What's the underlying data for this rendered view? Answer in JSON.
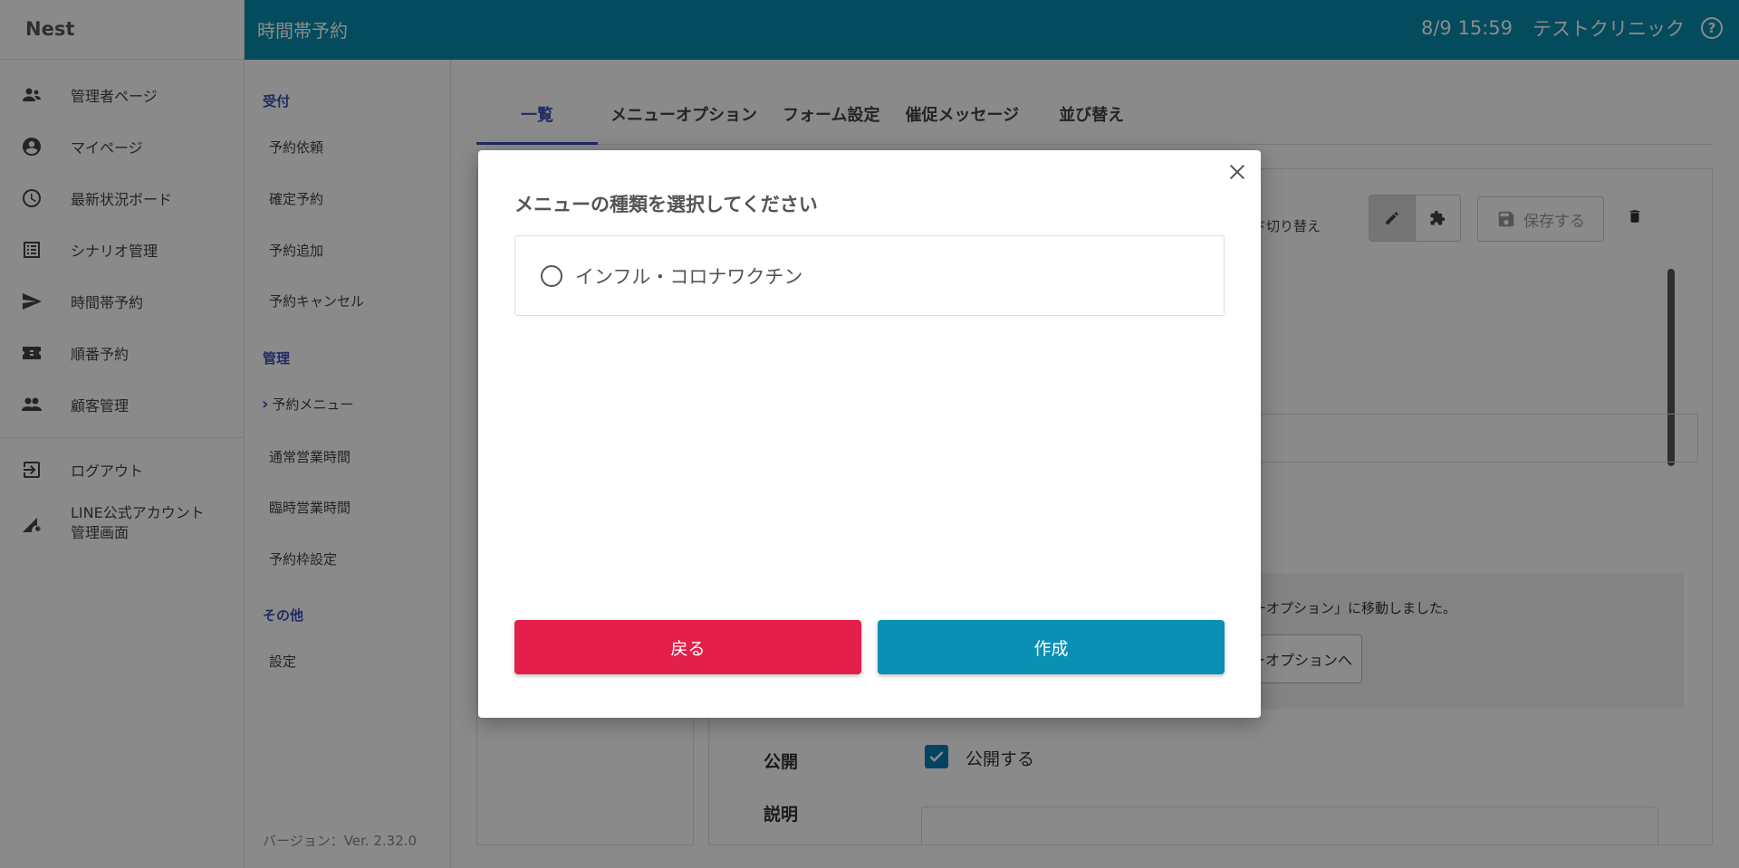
{
  "brand": "Nest",
  "header": {
    "title": "時間帯予約",
    "datetime": "8/9 15:59",
    "clinic": "テストクリニック",
    "help_glyph": "?"
  },
  "sidebar": {
    "items": [
      {
        "label": "管理者ページ",
        "icon": "admin-icon"
      },
      {
        "label": "マイページ",
        "icon": "account-icon"
      },
      {
        "label": "最新状況ボード",
        "icon": "clock-icon"
      },
      {
        "label": "シナリオ管理",
        "icon": "list-icon"
      },
      {
        "label": "時間帯予約",
        "icon": "send-icon"
      },
      {
        "label": "順番予約",
        "icon": "ticket-icon"
      },
      {
        "label": "顧客管理",
        "icon": "people-icon"
      }
    ],
    "logout": "ログアウト",
    "line_admin": [
      "LINE公式アカウント",
      "管理画面"
    ]
  },
  "subnav": {
    "sec_reception": "受付",
    "reception_items": [
      "予約依頼",
      "確定予約",
      "予約追加",
      "予約キャンセル"
    ],
    "sec_manage": "管理",
    "current": "予約メニュー",
    "manage_items": [
      "通常営業時間",
      "臨時営業時間",
      "予約枠設定"
    ],
    "sec_other": "その他",
    "other_items": [
      "設定"
    ],
    "version": "バージョン：Ver. 2.32.0"
  },
  "tabs": [
    "一覧",
    "メニューオプション",
    "フォーム設定",
    "催促メッセージ",
    "並び替え"
  ],
  "editor": {
    "mode_label": "ード切り替え",
    "save_label": "保存する",
    "notice_text": "ューオプション」に移動しました。",
    "notice_button": "ーオプションへ",
    "public_label": "公開",
    "public_check": "公開する",
    "desc_label": "説明"
  },
  "modal": {
    "title": "メニューの種類を選択してください",
    "option": "インフル・コロナワクチン",
    "back": "戻る",
    "create": "作成"
  },
  "colors": {
    "header": "#0a8bae",
    "accent": "#3f51b5",
    "back_button": "#e41f49",
    "create_button": "#0a8fb5"
  }
}
